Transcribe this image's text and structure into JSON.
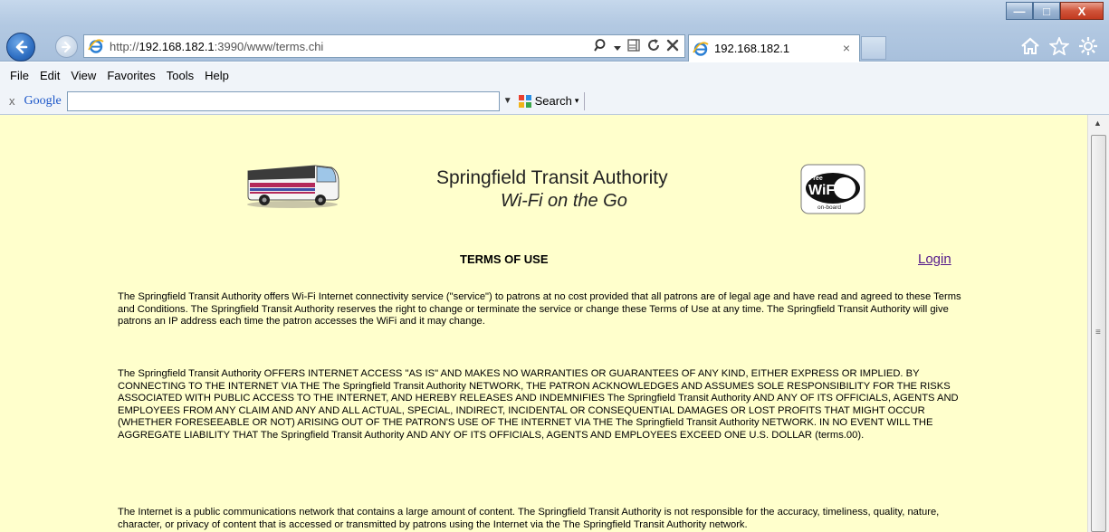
{
  "browser": {
    "address": {
      "scheme": "http://",
      "host": "192.168.182.1",
      "rest": ":3990/www/terms.chi"
    },
    "tab": {
      "title": "192.168.182.1",
      "close": "×"
    },
    "window_controls": {
      "minimize": "—",
      "maximize": "□",
      "close": "X"
    },
    "menu": [
      "File",
      "Edit",
      "View",
      "Favorites",
      "Tools",
      "Help"
    ],
    "google_toolbar": {
      "close": "x",
      "logo": "Google",
      "search_value": "",
      "search_label": "Search"
    }
  },
  "page": {
    "background": "#ffffcc",
    "title": "Springfield Transit Authority",
    "subtitle": "Wi-Fi on the Go",
    "wifi_badge": {
      "top": "Free",
      "main": "WiFi",
      "bottom": "on-board"
    },
    "terms_heading": "TERMS OF USE",
    "login_label": "Login",
    "paragraphs": [
      "The Springfield Transit Authority offers Wi-Fi Internet connectivity service (\"service\") to patrons at no cost provided that all patrons are of legal age and have read and agreed to these Terms and Conditions. The Springfield Transit Authority reserves the right to change or terminate the service or change these Terms of Use at any time. The Springfield Transit Authority will give patrons an IP address each time the patron accesses the WiFi and it may change.",
      "The Springfield Transit Authority OFFERS INTERNET ACCESS \"AS IS\" AND MAKES NO WARRANTIES OR GUARANTEES OF ANY KIND, EITHER EXPRESS OR IMPLIED. BY CONNECTING TO THE INTERNET VIA THE The Springfield Transit Authority NETWORK, THE PATRON ACKNOWLEDGES AND ASSUMES SOLE RESPONSIBILITY FOR THE RISKS ASSOCIATED WITH PUBLIC ACCESS TO THE INTERNET, AND HEREBY RELEASES AND INDEMNIFIES The Springfield Transit Authority AND ANY OF ITS OFFICIALS, AGENTS AND EMPLOYEES FROM ANY CLAIM AND ANY AND ALL ACTUAL, SPECIAL, INDIRECT, INCIDENTAL OR CONSEQUENTIAL DAMAGES OR LOST PROFITS THAT MIGHT OCCUR (WHETHER FORESEEABLE OR NOT) ARISING OUT OF THE PATRON'S USE OF THE INTERNET VIA THE The Springfield Transit Authority NETWORK. IN NO EVENT WILL THE AGGREGATE LIABILITY THAT The Springfield Transit Authority AND ANY OF ITS OFFICIALS, AGENTS AND EMPLOYEES EXCEED ONE U.S. DOLLAR (terms.00).",
      "The Internet is a public communications network that contains a large amount of content. The Springfield Transit Authority is not responsible for the accuracy, timeliness, quality, nature, character, or privacy of content that is accessed or transmitted by patrons using the Internet via the The Springfield Transit Authority network."
    ]
  }
}
